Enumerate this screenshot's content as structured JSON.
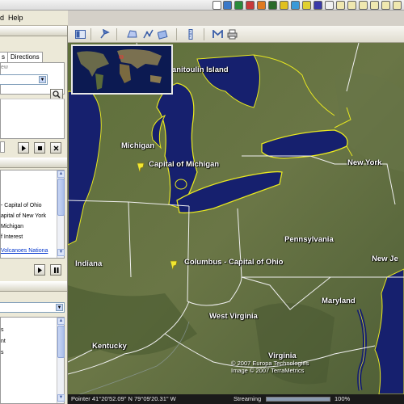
{
  "menu": {
    "items": [
      "d",
      "Help"
    ]
  },
  "sidebar": {
    "search_field": {
      "value": "ew"
    },
    "tabs": [
      "s",
      "Directions"
    ],
    "places": [
      {
        "label": "- Capital of Ohio",
        "link": false
      },
      {
        "label": "apital of New York",
        "link": false
      },
      {
        "label": "Michigan",
        "link": false
      },
      {
        "label": "f Interest",
        "link": false
      },
      {
        "label": "Volcanoes Nationa",
        "link": true
      }
    ],
    "layers_list": [
      "s",
      "nt",
      "s"
    ]
  },
  "map": {
    "labels": {
      "mantoulin": "Manitoulin Island",
      "michigan": "Michigan",
      "capital_michigan": "Capital of Michigan",
      "new_york": "New York",
      "pennsylvania": "Pennsylvania",
      "indiana": "Indiana",
      "columbus": "Columbus - Capital of Ohio",
      "new_jersey": "New Je",
      "maryland": "Maryland",
      "west_virginia": "West Virginia",
      "kentucky": "Kentucky",
      "virginia": "Virginia"
    },
    "copyright": [
      "© 2007 Europa Technologies",
      "Image © 2007 TerraMetrics"
    ]
  },
  "status": {
    "pointer": "Pointer  41°20'52.09\" N   79°09'20.31\" W",
    "streaming_label": "Streaming",
    "streaming_percent": "100%",
    "streaming_fraction": 1.0
  },
  "colors": {
    "lake": "#16206e",
    "border_yellow": "#e8e820",
    "land": "#5c6b3e"
  },
  "icons": {
    "toolbar": [
      "sidebar-toggle-icon",
      "add-placemark-icon",
      "add-polygon-icon",
      "add-path-icon",
      "add-overlay-icon",
      "ruler-icon",
      "email-icon",
      "print-icon"
    ],
    "tray": [
      "app-tray-icon"
    ]
  }
}
